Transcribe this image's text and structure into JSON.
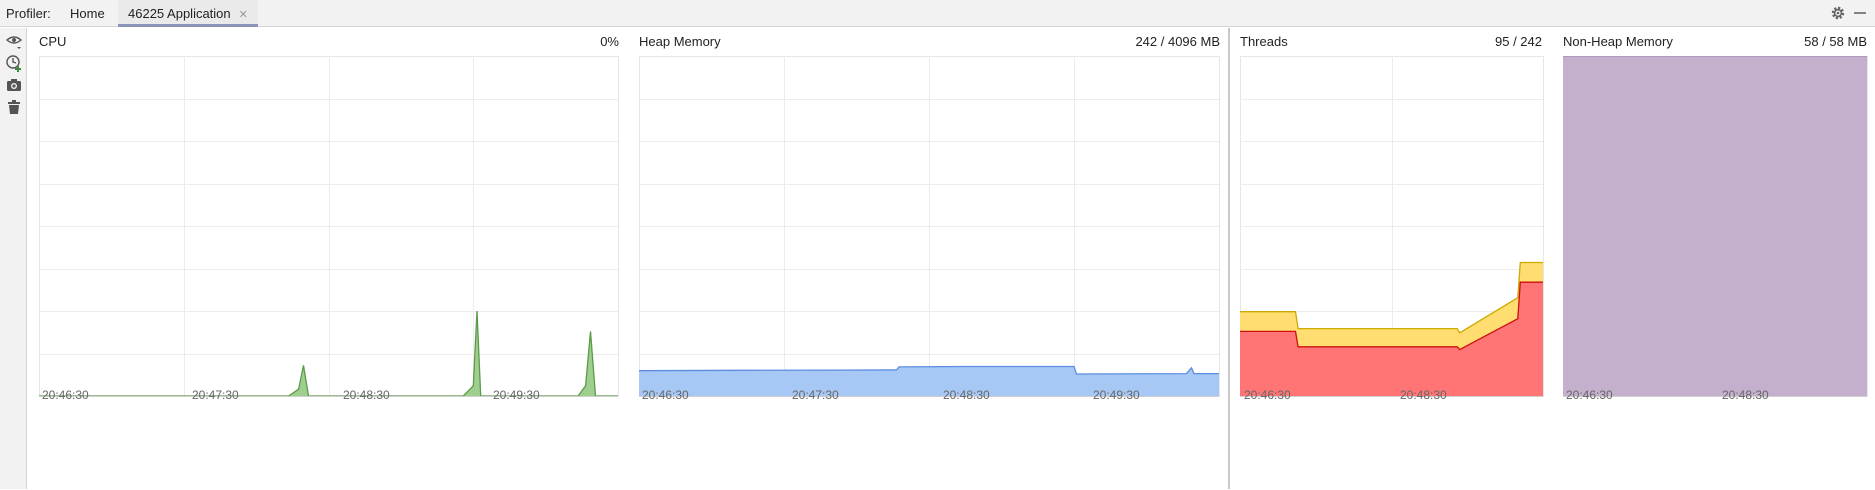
{
  "header": {
    "prefix": "Profiler:",
    "tabs": [
      {
        "label": "Home",
        "active": false
      },
      {
        "label": "46225 Application",
        "active": true,
        "closable": true
      }
    ],
    "close_icon": "close-icon",
    "settings_icon": "gear-icon",
    "minimize_icon": "minimize-icon"
  },
  "toolbar": {
    "items": [
      {
        "icon": "eye-dropdown-icon"
      },
      {
        "icon": "clock-add-icon"
      },
      {
        "icon": "camera-icon"
      },
      {
        "icon": "trash-icon"
      }
    ]
  },
  "panels": {
    "cpu": {
      "title": "CPU",
      "value": "0%",
      "x_ticks": [
        "20:46:30",
        "20:47:30",
        "20:48:30",
        "20:49:30"
      ]
    },
    "heap": {
      "title": "Heap Memory",
      "value": "242 / 4096 MB",
      "x_ticks": [
        "20:46:30",
        "20:47:30",
        "20:48:30",
        "20:49:30"
      ]
    },
    "threads": {
      "title": "Threads",
      "value": "95 / 242",
      "x_ticks": [
        "20:46:30",
        "20:48:30"
      ]
    },
    "nonheap": {
      "title": "Non-Heap Memory",
      "value": "58 / 58 MB",
      "x_ticks": [
        "20:46:30",
        "20:48:30"
      ]
    }
  },
  "chart_data": [
    {
      "type": "area",
      "title": "CPU",
      "color": "#5b9a4a",
      "fill": "#9fcf8f",
      "ylim": [
        0,
        100
      ],
      "xlim": [
        0,
        232
      ],
      "x_ticks": [
        "20:46:30",
        "20:47:30",
        "20:48:30",
        "20:49:30"
      ],
      "series": [
        {
          "x": [
            0,
            100,
            104,
            106,
            108,
            170,
            174,
            175.5,
            177,
            216,
            219,
            221,
            223,
            232
          ],
          "values": [
            0,
            0,
            2,
            9,
            0,
            0,
            3,
            25,
            0,
            0,
            3,
            19,
            0,
            0
          ]
        }
      ]
    },
    {
      "type": "area",
      "title": "Heap Memory",
      "color": "#5b8ee0",
      "fill": "#a7c7f5",
      "ylim": [
        0,
        4096
      ],
      "xlim": [
        0,
        232
      ],
      "x_ticks": [
        "20:46:30",
        "20:47:30",
        "20:48:30",
        "20:49:30"
      ],
      "series": [
        {
          "x": [
            0,
            40,
            80,
            103,
            104,
            130,
            174,
            175,
            219,
            221,
            222,
            232
          ],
          "values": [
            305,
            310,
            312,
            315,
            350,
            355,
            355,
            265,
            270,
            340,
            270,
            270
          ]
        }
      ]
    },
    {
      "type": "area",
      "title": "Threads",
      "ylim": [
        0,
        242
      ],
      "xlim": [
        0,
        120
      ],
      "x_ticks": [
        "20:46:30",
        "20:48:30"
      ],
      "series": [
        {
          "color": "#ccaa00",
          "fill": "#ffdd71",
          "x": [
            0,
            22,
            23,
            86,
            87,
            110,
            111,
            120
          ],
          "values": [
            60,
            60,
            48,
            48,
            45,
            70,
            95,
            95
          ]
        },
        {
          "color": "#cc1111",
          "fill": "#ff7575",
          "x": [
            0,
            22,
            23,
            86,
            87,
            110,
            111,
            120
          ],
          "values": [
            46,
            46,
            35,
            35,
            33,
            55,
            81,
            81
          ]
        }
      ]
    },
    {
      "type": "area",
      "title": "Non-Heap Memory",
      "color": "#a58bb5",
      "fill": "#c4b0cc",
      "ylim": [
        0,
        58
      ],
      "xlim": [
        0,
        120
      ],
      "x_ticks": [
        "20:46:30",
        "20:48:30"
      ],
      "series": [
        {
          "x": [
            0,
            120
          ],
          "values": [
            58,
            58
          ]
        }
      ]
    }
  ]
}
